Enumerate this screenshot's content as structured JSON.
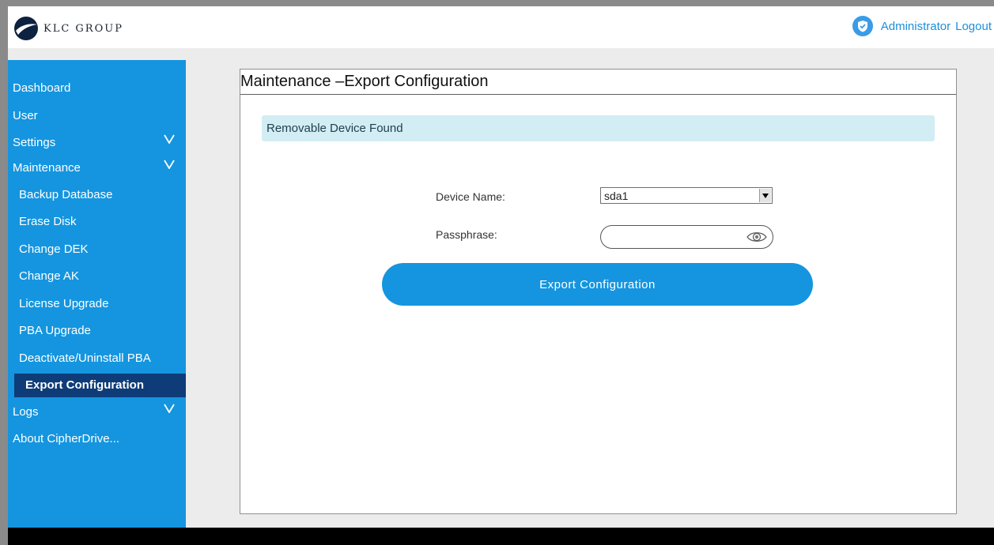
{
  "header": {
    "logo_text": "KLC GROUP",
    "user_label": "Administrator",
    "logout_label": "Logout"
  },
  "sidebar": {
    "items": [
      {
        "label": "Dashboard",
        "sub": false,
        "expandable": false,
        "active": false
      },
      {
        "label": "User",
        "sub": false,
        "expandable": false,
        "active": false
      },
      {
        "label": "Settings",
        "sub": false,
        "expandable": true,
        "active": false
      },
      {
        "label": "Maintenance",
        "sub": false,
        "expandable": true,
        "active": false
      },
      {
        "label": "Backup Database",
        "sub": true,
        "expandable": false,
        "active": false
      },
      {
        "label": "Erase Disk",
        "sub": true,
        "expandable": false,
        "active": false
      },
      {
        "label": "Change DEK",
        "sub": true,
        "expandable": false,
        "active": false
      },
      {
        "label": "Change AK",
        "sub": true,
        "expandable": false,
        "active": false
      },
      {
        "label": "License Upgrade",
        "sub": true,
        "expandable": false,
        "active": false
      },
      {
        "label": "PBA Upgrade",
        "sub": true,
        "expandable": false,
        "active": false
      },
      {
        "label": "Deactivate/Uninstall PBA",
        "sub": true,
        "expandable": false,
        "active": false
      },
      {
        "label": "Export Configuration",
        "sub": true,
        "expandable": false,
        "active": true
      },
      {
        "label": "Logs",
        "sub": false,
        "expandable": true,
        "active": false
      },
      {
        "label": "About CipherDrive...",
        "sub": false,
        "expandable": false,
        "active": false
      }
    ]
  },
  "main": {
    "title": "Maintenance –Export Configuration",
    "notice": "Removable Device Found",
    "device_label": "Device Name:",
    "device_value": "sda1",
    "passphrase_label": "Passphrase:",
    "passphrase_value": "",
    "export_button": "Export Configuration"
  },
  "colors": {
    "sidebar": "#1595df",
    "sidebar_active": "#0e3c78",
    "accent": "#1595df",
    "notice_bg": "#d3edf4",
    "link": "#1b8fdc"
  }
}
